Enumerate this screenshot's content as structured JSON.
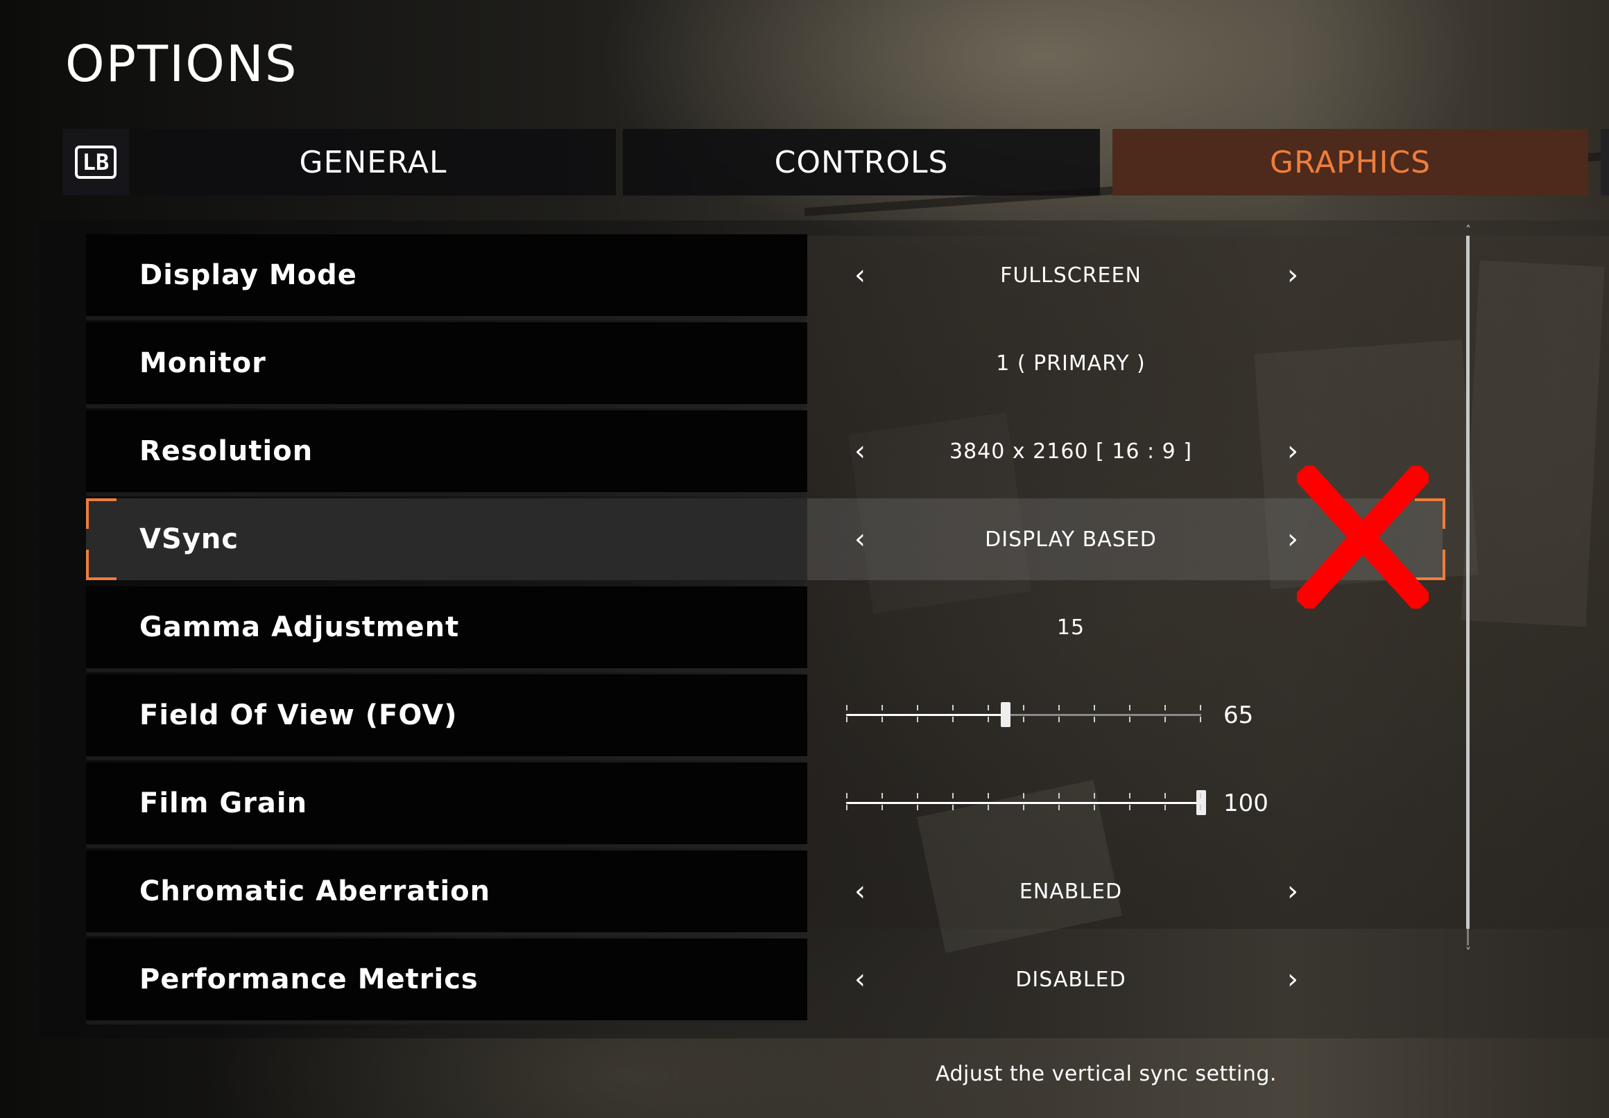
{
  "header": {
    "title": "OPTIONS"
  },
  "tabs": {
    "lb_label": "LB",
    "items": [
      {
        "label": "GENERAL",
        "active": false
      },
      {
        "label": "CONTROLS",
        "active": false
      },
      {
        "label": "GRAPHICS",
        "active": true
      }
    ]
  },
  "accent_color": "#EE7D3C",
  "settings": [
    {
      "label": "Display Mode",
      "value": "FULLSCREEN",
      "kind": "selector",
      "arrows": true
    },
    {
      "label": "Monitor",
      "value": "1 ( PRIMARY )",
      "kind": "selector",
      "arrows": false
    },
    {
      "label": "Resolution",
      "value": "3840 x 2160 [ 16 :  9 ]",
      "kind": "selector",
      "arrows": true
    },
    {
      "label": "VSync",
      "value": "DISPLAY BASED",
      "kind": "selector",
      "arrows": true,
      "selected": true
    },
    {
      "label": "Gamma Adjustment",
      "value": "15",
      "kind": "value",
      "arrows": false
    },
    {
      "label": "Field Of View (FOV)",
      "value": "65",
      "kind": "slider",
      "slider_fraction": 0.45
    },
    {
      "label": "Film Grain",
      "value": "100",
      "kind": "slider",
      "slider_fraction": 1.0
    },
    {
      "label": "Chromatic Aberration",
      "value": "ENABLED",
      "kind": "selector",
      "arrows": true
    },
    {
      "label": "Performance Metrics",
      "value": "DISABLED",
      "kind": "selector",
      "arrows": true
    }
  ],
  "icons": {
    "left_arrow": "chevron-left-icon",
    "right_arrow": "chevron-right-icon",
    "overlay": "red-x-icon"
  },
  "footer": {
    "hint": "Adjust the vertical sync setting."
  }
}
